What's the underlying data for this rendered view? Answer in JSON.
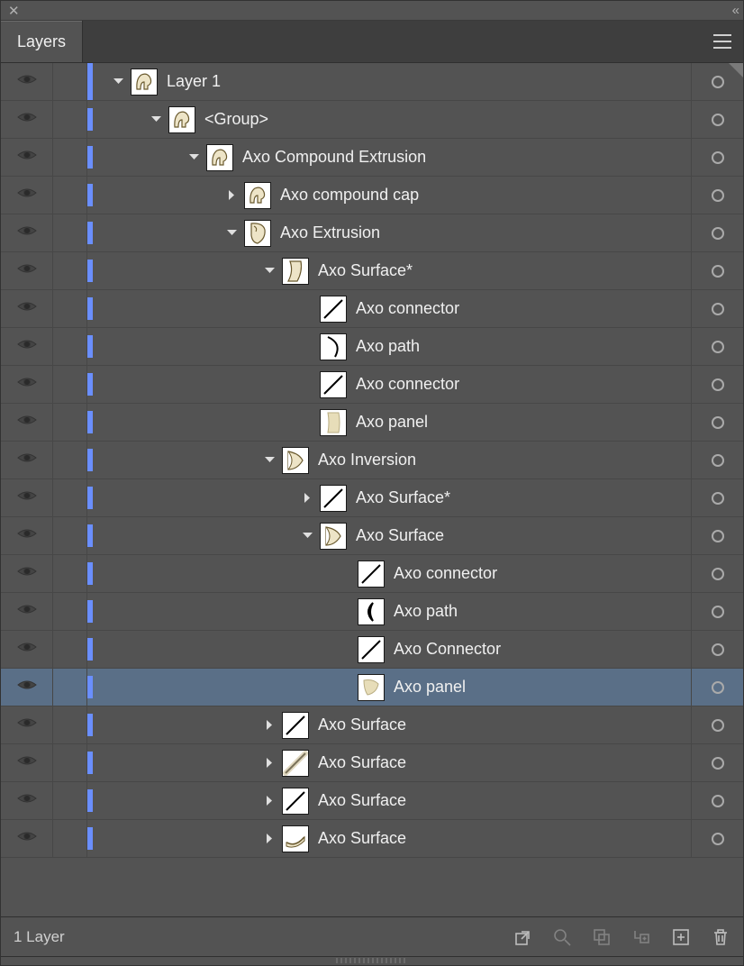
{
  "panel": {
    "title": "Layers",
    "footer_count": "1 Layer"
  },
  "rows": [
    {
      "label": "Layer 1",
      "indent": 0,
      "disclosure": "down",
      "thumb": "a",
      "selected": false,
      "barFull": true
    },
    {
      "label": "<Group>",
      "indent": 1,
      "disclosure": "down",
      "thumb": "a",
      "selected": false,
      "barFull": false
    },
    {
      "label": "Axo Compound Extrusion",
      "indent": 2,
      "disclosure": "down",
      "thumb": "a",
      "selected": false,
      "barFull": false
    },
    {
      "label": "Axo compound cap",
      "indent": 3,
      "disclosure": "right",
      "thumb": "a",
      "selected": false,
      "barFull": false
    },
    {
      "label": "Axo Extrusion",
      "indent": 3,
      "disclosure": "down",
      "thumb": "face",
      "selected": false,
      "barFull": false
    },
    {
      "label": "Axo Surface*",
      "indent": 4,
      "disclosure": "down",
      "thumb": "surface1",
      "selected": false,
      "barFull": false
    },
    {
      "label": "Axo connector",
      "indent": 5,
      "disclosure": "none",
      "thumb": "diag",
      "selected": false,
      "barFull": false
    },
    {
      "label": "Axo path",
      "indent": 5,
      "disclosure": "none",
      "thumb": "curve",
      "selected": false,
      "barFull": false
    },
    {
      "label": "Axo connector",
      "indent": 5,
      "disclosure": "none",
      "thumb": "diag",
      "selected": false,
      "barFull": false
    },
    {
      "label": "Axo panel",
      "indent": 5,
      "disclosure": "none",
      "thumb": "panel",
      "selected": false,
      "barFull": false
    },
    {
      "label": "Axo Inversion",
      "indent": 4,
      "disclosure": "down",
      "thumb": "inv",
      "selected": false,
      "barFull": false
    },
    {
      "label": "Axo Surface*",
      "indent": 5,
      "disclosure": "right",
      "thumb": "diag",
      "selected": false,
      "barFull": false
    },
    {
      "label": "Axo Surface",
      "indent": 5,
      "disclosure": "down",
      "thumb": "inv",
      "selected": false,
      "barFull": false
    },
    {
      "label": "Axo connector",
      "indent": 6,
      "disclosure": "none",
      "thumb": "diag",
      "selected": false,
      "barFull": false
    },
    {
      "label": "Axo path",
      "indent": 6,
      "disclosure": "none",
      "thumb": "moon",
      "selected": false,
      "barFull": false
    },
    {
      "label": "Axo Connector",
      "indent": 6,
      "disclosure": "none",
      "thumb": "diag",
      "selected": false,
      "barFull": false
    },
    {
      "label": "Axo panel",
      "indent": 6,
      "disclosure": "none",
      "thumb": "panel2",
      "selected": true,
      "barFull": false
    },
    {
      "label": "Axo Surface",
      "indent": 4,
      "disclosure": "right",
      "thumb": "diag",
      "selected": false,
      "barFull": false
    },
    {
      "label": "Axo Surface",
      "indent": 4,
      "disclosure": "right",
      "thumb": "diag2",
      "selected": false,
      "barFull": false
    },
    {
      "label": "Axo Surface",
      "indent": 4,
      "disclosure": "right",
      "thumb": "diag",
      "selected": false,
      "barFull": false
    },
    {
      "label": "Axo Surface",
      "indent": 4,
      "disclosure": "right",
      "thumb": "swoosh",
      "selected": false,
      "barFull": false
    }
  ]
}
